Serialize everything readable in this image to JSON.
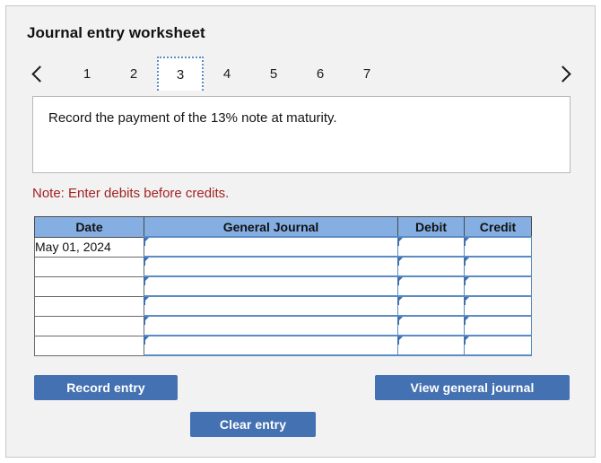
{
  "panel": {
    "title": "Journal entry worksheet"
  },
  "pager": {
    "prev_icon": "chevron-left-icon",
    "next_icon": "chevron-right-icon",
    "active_tab": "3",
    "tabs": [
      {
        "label": "1",
        "active": false
      },
      {
        "label": "2",
        "active": false
      },
      {
        "label": "3",
        "active": true
      },
      {
        "label": "4",
        "active": false
      },
      {
        "label": "5",
        "active": false
      },
      {
        "label": "6",
        "active": false
      },
      {
        "label": "7",
        "active": false
      }
    ]
  },
  "question": {
    "text": "Record the payment of the 13% note at maturity."
  },
  "note": {
    "text": "Note: Enter debits before credits.",
    "color": "#a32222"
  },
  "table": {
    "headers": [
      "Date",
      "General Journal",
      "Debit",
      "Credit"
    ],
    "rows": [
      {
        "date": "May 01, 2024",
        "general_journal": "",
        "debit": "",
        "credit": ""
      },
      {
        "date": "",
        "general_journal": "",
        "debit": "",
        "credit": ""
      },
      {
        "date": "",
        "general_journal": "",
        "debit": "",
        "credit": ""
      },
      {
        "date": "",
        "general_journal": "",
        "debit": "",
        "credit": ""
      },
      {
        "date": "",
        "general_journal": "",
        "debit": "",
        "credit": ""
      },
      {
        "date": "",
        "general_journal": "",
        "debit": "",
        "credit": ""
      }
    ],
    "header_color": "#85aee3",
    "input_border_color": "#5b8bc4"
  },
  "buttons": {
    "record_entry": "Record entry",
    "view_general_journal": "View general journal",
    "clear_entry": "Clear entry",
    "color": "#4471b2"
  }
}
